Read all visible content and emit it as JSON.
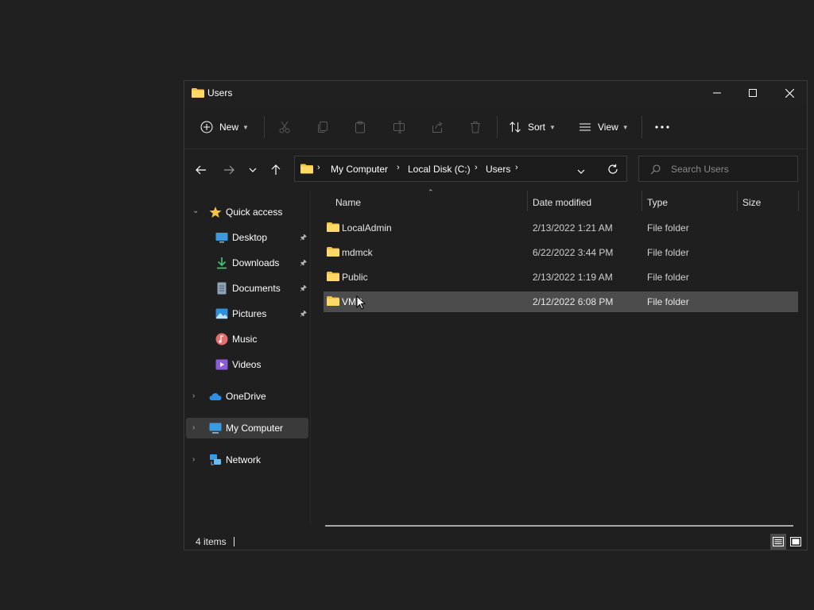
{
  "window": {
    "title": "Users"
  },
  "toolbar": {
    "new_label": "New",
    "sort_label": "Sort",
    "view_label": "View"
  },
  "address": {
    "crumbs": [
      "My Computer",
      "Local Disk (C:)",
      "Users"
    ]
  },
  "search": {
    "placeholder": "Search Users"
  },
  "sidebar": {
    "quick_access": "Quick access",
    "items": [
      {
        "label": "Desktop",
        "pinned": true,
        "icon": "desktop-icon"
      },
      {
        "label": "Downloads",
        "pinned": true,
        "icon": "download-icon"
      },
      {
        "label": "Documents",
        "pinned": true,
        "icon": "document-icon"
      },
      {
        "label": "Pictures",
        "pinned": true,
        "icon": "picture-icon"
      },
      {
        "label": "Music",
        "pinned": false,
        "icon": "music-icon"
      },
      {
        "label": "Videos",
        "pinned": false,
        "icon": "video-icon"
      }
    ],
    "onedrive": "OneDrive",
    "my_computer": "My Computer",
    "network": "Network"
  },
  "columns": {
    "name": "Name",
    "date": "Date modified",
    "type": "Type",
    "size": "Size"
  },
  "files": [
    {
      "name": "LocalAdmin",
      "date": "2/13/2022 1:21 AM",
      "type": "File folder"
    },
    {
      "name": "mdmck",
      "date": "6/22/2022 3:44 PM",
      "type": "File folder"
    },
    {
      "name": "Public",
      "date": "2/13/2022 1:19 AM",
      "type": "File folder"
    },
    {
      "name": "VMS",
      "date": "2/12/2022 6:08 PM",
      "type": "File folder",
      "selected": true
    }
  ],
  "status": {
    "count": "4 items"
  },
  "colors": {
    "folder": "#f6c445",
    "accent": "#4cc2ff"
  }
}
